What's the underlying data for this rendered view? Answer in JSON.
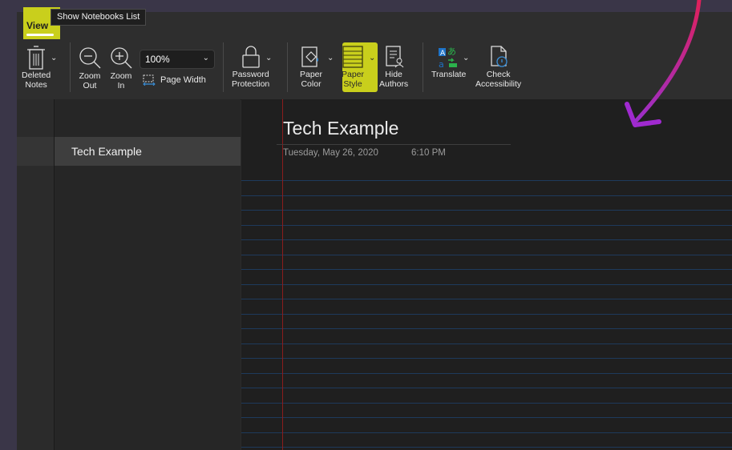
{
  "ribbon": {
    "active_tab": "View",
    "tooltip": "Show Notebooks List",
    "zoom_value": "100%",
    "page_width_label": "Page Width",
    "buttons": {
      "deleted_notes": "Deleted\nNotes",
      "zoom_out": "Zoom\nOut",
      "zoom_in": "Zoom\nIn",
      "password_protection": "Password\nProtection",
      "paper_color": "Paper\nColor",
      "paper_style": "Paper\nStyle",
      "hide_authors": "Hide\nAuthors",
      "translate": "Translate",
      "check_accessibility": "Check\nAccessibility"
    }
  },
  "navigation": {
    "pages": [
      "Tech Example"
    ]
  },
  "page": {
    "title": "Tech Example",
    "date": "Tuesday, May 26, 2020",
    "time": "6:10 PM"
  },
  "colors": {
    "highlight": "#c9cf1c",
    "annotation_arrow": "#c8209a",
    "rule_line": "#1e3a5c",
    "margin_line": "#8b1d1d"
  },
  "icons": [
    "trash-icon",
    "zoom-out-icon",
    "zoom-in-icon",
    "page-width-icon",
    "lock-icon",
    "paper-color-icon",
    "paper-style-icon",
    "hide-authors-icon",
    "translate-icon",
    "check-accessibility-icon",
    "chevron-down-icon",
    "annotation-arrow"
  ]
}
